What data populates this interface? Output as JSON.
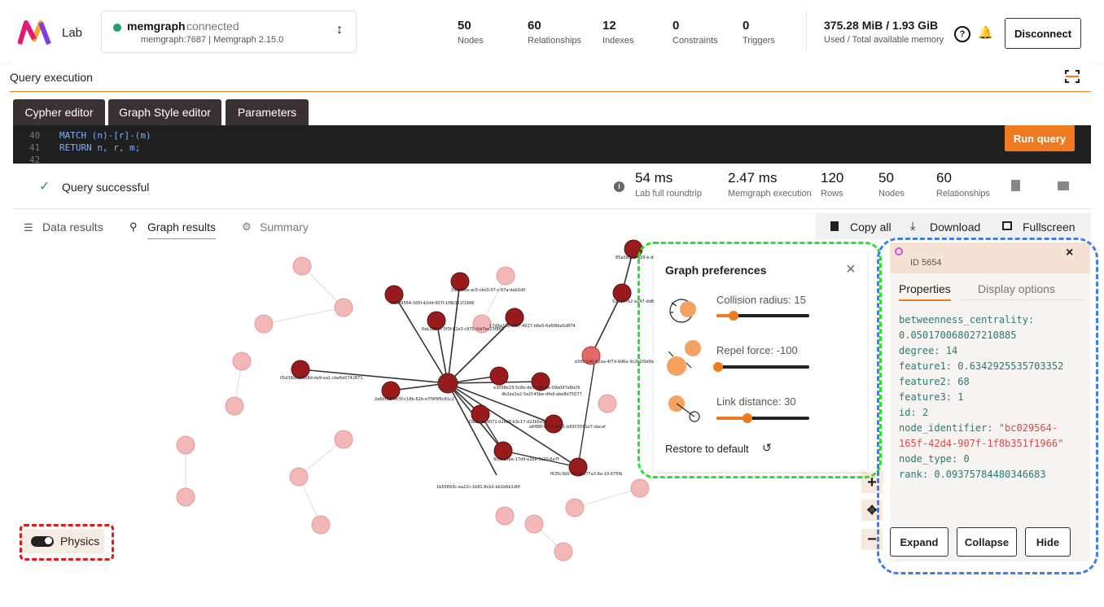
{
  "app": {
    "logo_label": "Lab"
  },
  "connection": {
    "db_name": "memgraph",
    "state": "connected",
    "details": "memgraph:7687 | Memgraph 2.15.0",
    "status_color": "#22a06b"
  },
  "stats": [
    {
      "value": "50",
      "label": "Nodes"
    },
    {
      "value": "60",
      "label": "Relationships"
    },
    {
      "value": "12",
      "label": "Indexes"
    },
    {
      "value": "0",
      "label": "Constraints"
    },
    {
      "value": "0",
      "label": "Triggers"
    }
  ],
  "memory": {
    "value": "375.28 MiB / 1.93 GiB",
    "label": "Used / Total available memory"
  },
  "header_actions": {
    "disconnect_label": "Disconnect"
  },
  "query_execution": {
    "title": "Query execution"
  },
  "editor_tabs": [
    "Cypher editor",
    "Graph Style editor",
    "Parameters"
  ],
  "editor": {
    "lines": [
      {
        "num": "40",
        "code": "MATCH (n)-[r]-(m)"
      },
      {
        "num": "41",
        "code": "RETURN n, r, m;"
      },
      {
        "num": "42",
        "code": ""
      }
    ],
    "run_label": "Run query"
  },
  "query_status": {
    "message": "Query successful",
    "metrics": [
      {
        "value": "54 ms",
        "label": "Lab full roundtrip"
      },
      {
        "value": "2.47 ms",
        "label": "Memgraph execution"
      },
      {
        "value": "120",
        "label": "Rows"
      },
      {
        "value": "50",
        "label": "Nodes"
      },
      {
        "value": "60",
        "label": "Relationships"
      }
    ]
  },
  "result_tabs": [
    "Data results",
    "Graph results",
    "Summary"
  ],
  "result_actions": {
    "copy_all": "Copy all",
    "download": "Download",
    "fullscreen": "Fullscreen"
  },
  "graph_preferences": {
    "title": "Graph preferences",
    "collision": {
      "label": "Collision radius: 15",
      "fraction": 0.17
    },
    "repel": {
      "label": "Repel force: -100",
      "fraction": 0.0
    },
    "link": {
      "label": "Link distance: 30",
      "fraction": 0.32
    },
    "restore_label": "Restore to default"
  },
  "node_panel": {
    "id_label": "ID 5654",
    "tabs": [
      "Properties",
      "Display options"
    ],
    "properties": [
      {
        "key": "betweenness_centrality",
        "value": "0.050170068027210885"
      },
      {
        "key": "degree",
        "value": "14"
      },
      {
        "key": "feature1",
        "value": "0.6342925535703352"
      },
      {
        "key": "feature2",
        "value": "68"
      },
      {
        "key": "feature3",
        "value": "1"
      },
      {
        "key": "id",
        "value": "2"
      },
      {
        "key": "node_identifier",
        "value": "\"bc029564-165f-42d4-907f-1f8b351f1966\""
      },
      {
        "key": "node_type",
        "value": "0"
      },
      {
        "key": "rank",
        "value": "0.09375784480346683"
      }
    ],
    "buttons": [
      "Expand",
      "Collapse",
      "Hide"
    ]
  },
  "physics": {
    "label": "Physics"
  },
  "graph_labels": [
    "bc029564-165f-42d4-907f-1f8b351f1966",
    "33ab69a-ac0-cbc0-07-c-67a-dab1d0",
    "6ab1bb9c-0f3f-b2e3-c970-fcb7ec23f865",
    "17d9a328-0f07-4027-b6e0-6a6f8ba5d874",
    "05d38d2e-558d-de9-ea1-cbe6e0742871",
    "2a6bf1bf-bc5f-c18b-62b-e7f9f9f6c81c2",
    "e3058e23-5c8e-de53-95-be-09a097e8d29",
    "4b2aa1e2-5e2f-45be-dfe9-abe8d75077",
    "f3b3c3c-9071-d2ea8-b3c17-d23b5e5e",
    "a6f88f-d5c3-de51-b63f-5561e7-dacaf",
    "9c09a3be-17d9-e2ee-5c20-6e7f",
    "f635c3b0-f47-d-e77a3-6e-10-675fb",
    "85a0d3e2-a29-b-d45-ea7c732c3ae7e90d",
    "52e147e2-a147-dd8-a65b-058d3fefed82",
    "e5f8c1d0-b2aa-4f7d-9d6e-3c2b1f0e8a7d",
    "1b55893c-ea22c-1b81-8cb2-bb1b6b1d0f"
  ]
}
